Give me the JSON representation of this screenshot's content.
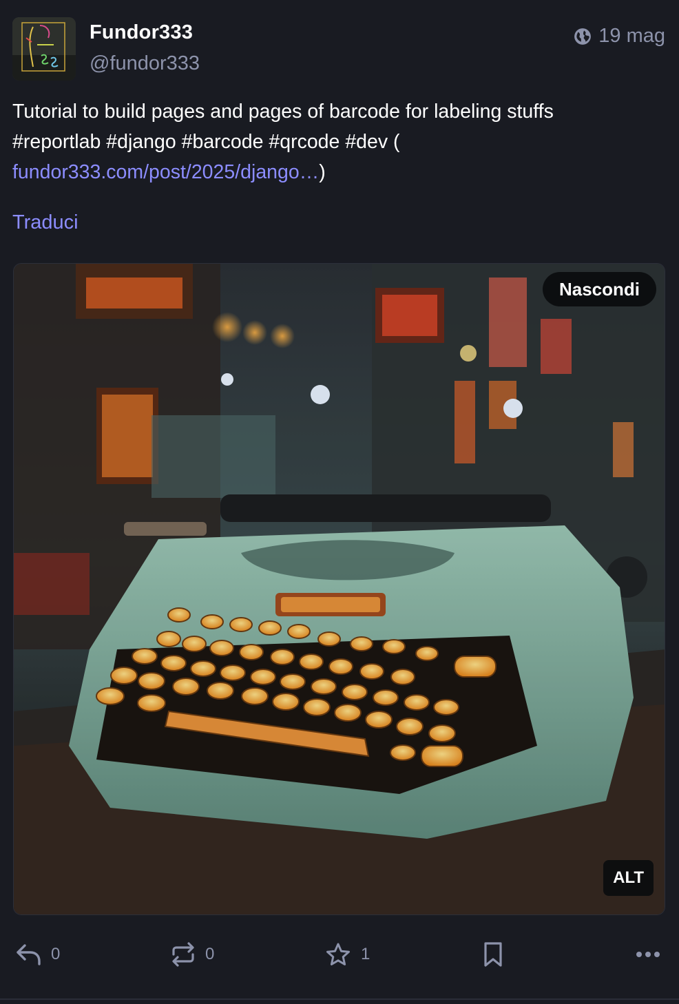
{
  "author": {
    "display_name": "Fundor333",
    "handle": "@fundor333",
    "avatar_icon": "avatar-image"
  },
  "meta": {
    "visibility_icon": "globe-icon",
    "timestamp": "19 mag"
  },
  "content": {
    "line1": "Tutorial to build pages and pages of barcode for labeling stuffs",
    "hashtags": [
      "#reportlab",
      "#django",
      "#barcode",
      "#qrcode",
      "#dev"
    ],
    "open_paren": "(",
    "link_text": "fundor333.com/post/2025/django…",
    "close_paren": ")"
  },
  "translate_label": "Traduci",
  "media": {
    "hide_label": "Nascondi",
    "alt_label": "ALT"
  },
  "actions": {
    "reply": {
      "icon": "reply-icon",
      "count": "0"
    },
    "boost": {
      "icon": "boost-icon",
      "count": "0"
    },
    "favourite": {
      "icon": "star-icon",
      "count": "1"
    },
    "bookmark": {
      "icon": "bookmark-icon"
    },
    "more": {
      "icon": "more-icon"
    }
  },
  "colors": {
    "background": "#191b22",
    "text": "#ffffff",
    "muted": "#8d93ab",
    "link": "#8c8dff"
  }
}
